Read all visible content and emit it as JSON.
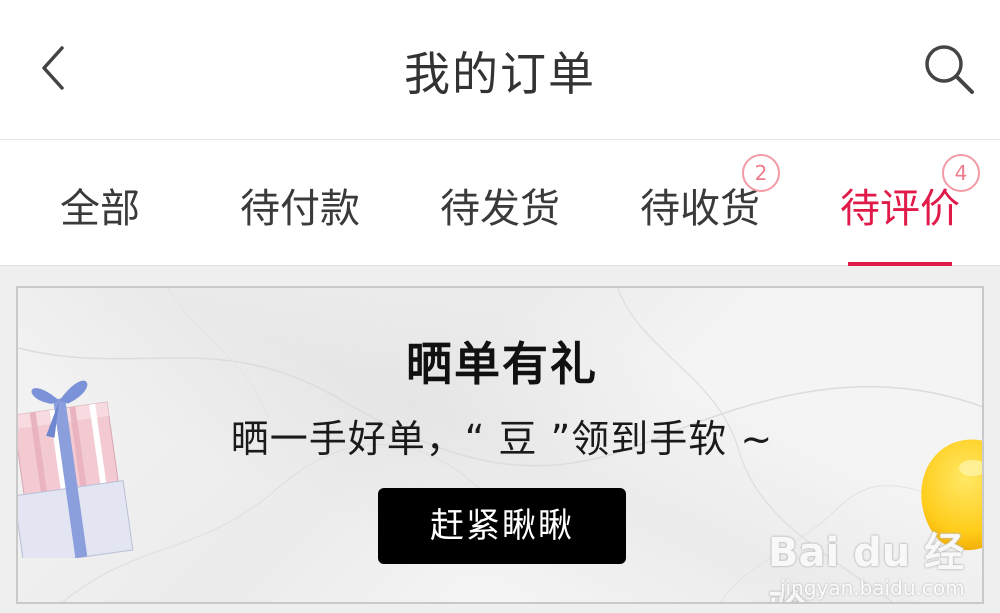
{
  "header": {
    "title": "我的订单",
    "back_icon": "chevron-left-icon",
    "search_icon": "search-icon"
  },
  "tabs": [
    {
      "label": "全部",
      "badge": null,
      "active": false
    },
    {
      "label": "待付款",
      "badge": null,
      "active": false
    },
    {
      "label": "待发货",
      "badge": null,
      "active": false
    },
    {
      "label": "待收货",
      "badge": "2",
      "active": false
    },
    {
      "label": "待评价",
      "badge": "4",
      "active": true
    }
  ],
  "banner": {
    "title": "晒单有礼",
    "subtitle": "晒一手好单，“ 豆 ”领到手软 ~",
    "cta_label": "赶紧瞅瞅"
  },
  "watermark": {
    "text": "Bai du 经验",
    "url": "jingyan.baidu.com"
  },
  "colors": {
    "accent": "#e11b49",
    "badge_border": "#f49aa6",
    "cta_bg": "#000000",
    "banner_bg": "#f4f4f4"
  }
}
